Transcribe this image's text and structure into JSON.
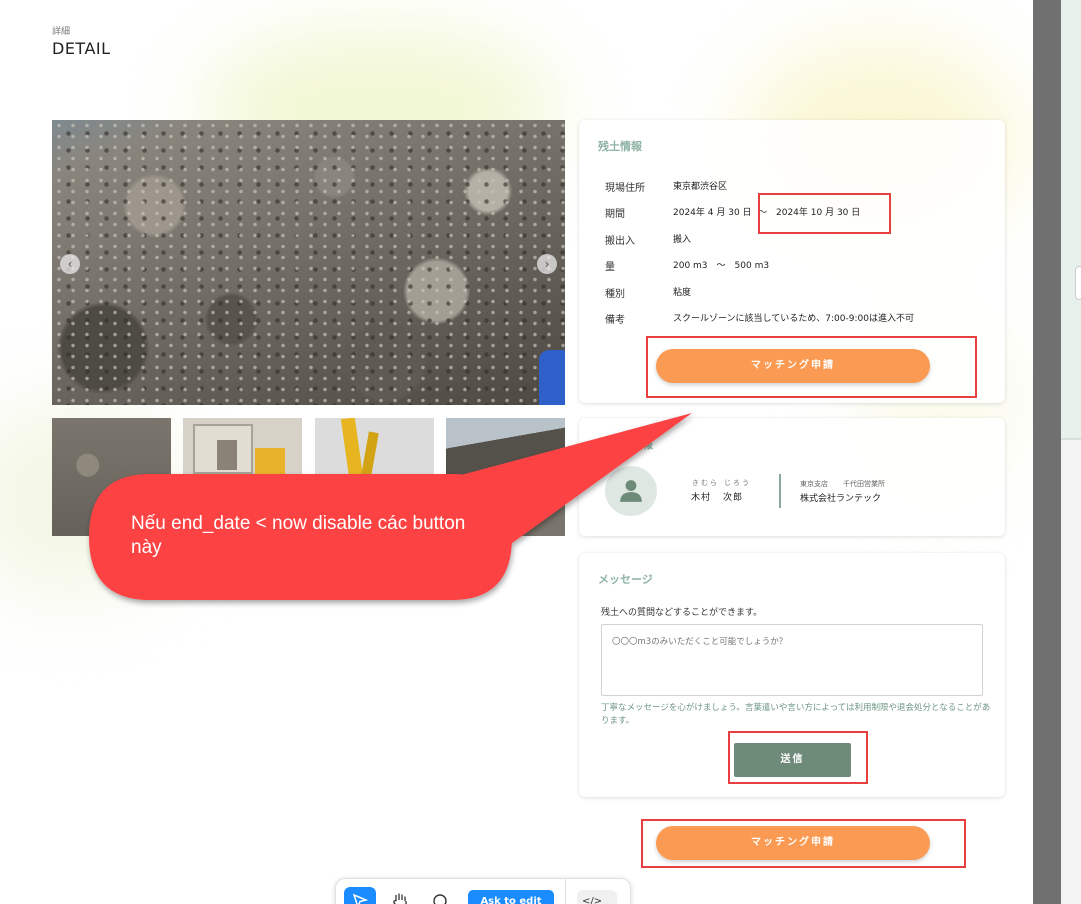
{
  "header": {
    "subtitle": "詳細",
    "title": "DETAIL"
  },
  "gallery": {
    "prev_icon": "‹",
    "next_icon": "›",
    "thumbnails": 4
  },
  "soil_info": {
    "title": "残土情報",
    "rows": [
      {
        "label": "現場住所",
        "value": "東京都渋谷区"
      },
      {
        "label": "期間",
        "value_start": "2024年 4 月 30 日",
        "separator": "〜",
        "value_end": "2024年 10 月 30 日"
      },
      {
        "label": "搬出入",
        "value": "搬入"
      },
      {
        "label": "量",
        "value": "200 m3　〜　500 m3"
      },
      {
        "label": "種別",
        "value": "粘度"
      },
      {
        "label": "備考",
        "value": "スクールゾーンに該当しているため、7:00-9:00は進入不可"
      }
    ],
    "match_button": "マッチング申請"
  },
  "poster": {
    "title": "出品者情報",
    "furigana_last": "きむら",
    "furigana_first": "じろう",
    "name_last": "木村",
    "name_first": "次郎",
    "branch": "東京支店",
    "office": "千代田営業所",
    "company": "株式会社ランテック"
  },
  "message": {
    "title": "メッセージ",
    "description": "残土への質問などすることができます。",
    "placeholder": "〇〇〇m3のみいただくこと可能でしょうか？",
    "note": "丁寧なメッセージを心がけましょう。言葉遣いや言い方によっては利用制限や退会処分となることがあります。",
    "send_button": "送信"
  },
  "bottom_match_button": "マッチング申請",
  "annotation": {
    "text": "Nếu end_date < now disable các button này"
  },
  "toolbar": {
    "ask_label": "Ask to edit",
    "code_label": "</>"
  },
  "colors": {
    "orange": "#fb9a52",
    "green": "#6e8b7a",
    "highlight": "#e84040",
    "bubble": "#fc4242"
  }
}
